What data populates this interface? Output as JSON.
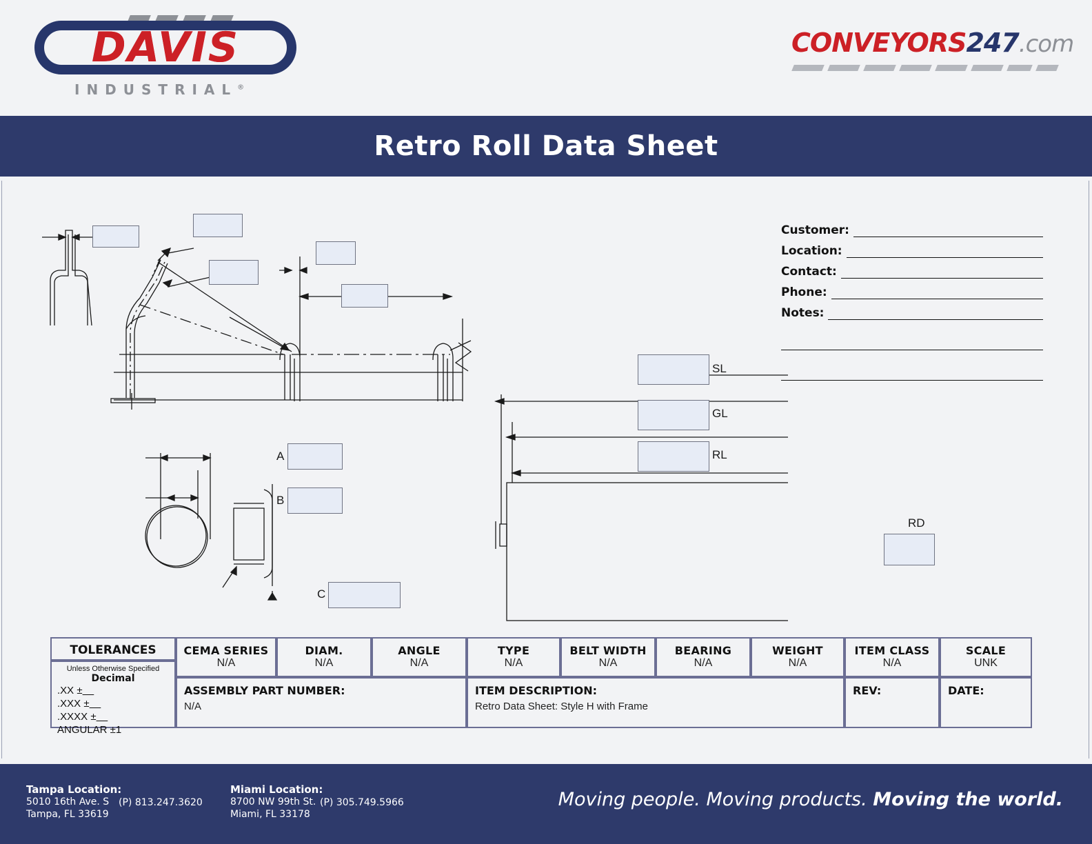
{
  "header": {
    "davis_logo": {
      "main_text": "DAVIS",
      "sub_text": "INDUSTRIAL",
      "registered_mark": "®",
      "icon": "davis-industrial-logo",
      "red": "#cc2026",
      "navy": "#27366b",
      "gray": "#8d9096"
    },
    "conveyors_logo": {
      "part1": "CONVEYORS",
      "part2": "247",
      "part3": ".com",
      "icon": "conveyors247-logo",
      "red": "#cc2026",
      "navy": "#27366b",
      "gray": "#8d9096"
    }
  },
  "banner": {
    "title": "Retro Roll Data Sheet",
    "background": "#2e3a6b",
    "text_color": "#ffffff"
  },
  "info": {
    "fields": [
      {
        "label": "Customer:",
        "value": ""
      },
      {
        "label": "Location:",
        "value": ""
      },
      {
        "label": "Contact:",
        "value": ""
      },
      {
        "label": "Phone:",
        "value": ""
      },
      {
        "label": "Notes:",
        "value": ""
      }
    ],
    "extra_blank_lines": 2
  },
  "drawing": {
    "callouts": [
      {
        "name": "frame-gap-dim",
        "label": "",
        "value": ""
      },
      {
        "name": "idler-angle-dim",
        "label": "",
        "value": ""
      },
      {
        "name": "wing-roll-dim",
        "label": "",
        "value": ""
      },
      {
        "name": "center-roll-dim",
        "label": "",
        "value": ""
      },
      {
        "name": "frame-spacing-dim",
        "label": "",
        "value": ""
      }
    ],
    "detail_labels": [
      {
        "label": "A",
        "value": ""
      },
      {
        "label": "B",
        "value": ""
      },
      {
        "label": "C",
        "value": ""
      }
    ],
    "roll_dims": [
      {
        "label": "SL",
        "value": ""
      },
      {
        "label": "GL",
        "value": ""
      },
      {
        "label": "RL",
        "value": ""
      },
      {
        "label": "RD",
        "value": ""
      }
    ],
    "box_fill": "#e7ecf6",
    "box_border": "#6f7382",
    "line_color": "#1a1a1a"
  },
  "title_table": {
    "tolerances": {
      "heading": "TOLERANCES",
      "subheading": "Unless Otherwise Specified",
      "decimal_label": "Decimal",
      "lines": [
        ".XX ±",
        ".XXX ±",
        ".XXXX ±",
        "ANGULAR ±1"
      ]
    },
    "columns": [
      {
        "header": "CEMA SERIES",
        "value": "N/A"
      },
      {
        "header": "DIAM.",
        "value": "N/A"
      },
      {
        "header": "ANGLE",
        "value": "N/A"
      },
      {
        "header": "TYPE",
        "value": "N/A"
      },
      {
        "header": "BELT WIDTH",
        "value": "N/A"
      },
      {
        "header": "BEARING",
        "value": "N/A"
      },
      {
        "header": "WEIGHT",
        "value": "N/A"
      },
      {
        "header": "ITEM CLASS",
        "value": "N/A"
      },
      {
        "header": "SCALE",
        "value": "UNK"
      }
    ],
    "assembly": {
      "label": "ASSEMBLY PART NUMBER:",
      "value": "N/A"
    },
    "description": {
      "label": "ITEM DESCRIPTION:",
      "value": "Retro Data Sheet: Style H with Frame"
    },
    "rev": {
      "label": "REV:",
      "value": ""
    },
    "date": {
      "label": "DATE:",
      "value": ""
    },
    "border_color": "#6b6e94"
  },
  "footer": {
    "tampa": {
      "title": "Tampa Location:",
      "street": "5010 16th Ave. S",
      "city": "Tampa, FL 33619",
      "phone": "(P) 813.247.3620"
    },
    "miami": {
      "title": "Miami Location:",
      "street": "8700 NW 99th St.",
      "city": "Miami, FL 33178",
      "phone": "(P) 305.749.5966"
    },
    "tagline_light": "Moving people. Moving products. ",
    "tagline_bold": "Moving the world.",
    "background": "#2e3a6b"
  }
}
